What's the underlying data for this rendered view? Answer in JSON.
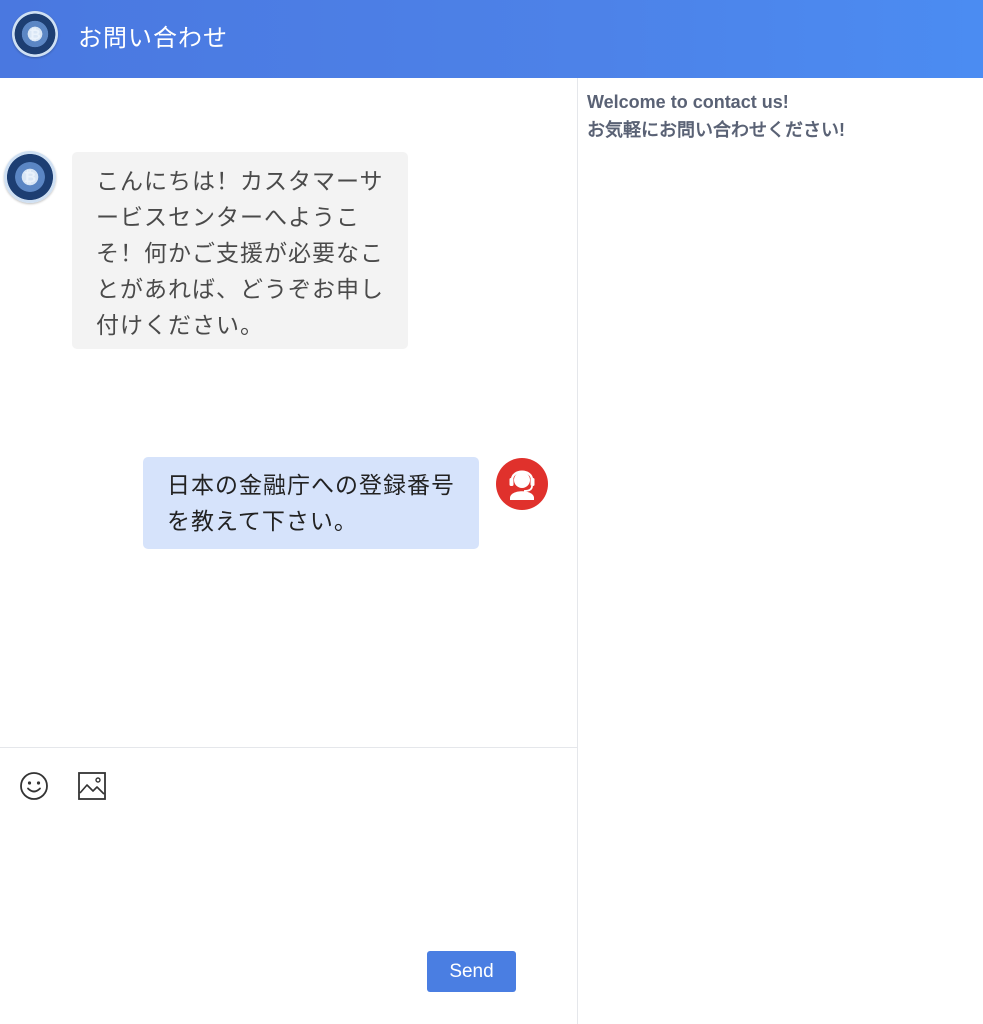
{
  "header": {
    "title": "お問い合わせ",
    "logo_icon": "bitcoin-logo-icon"
  },
  "messages": [
    {
      "sender": "agent",
      "avatar_icon": "bitcoin-logo-icon",
      "text": "こんにちは！カスタマーサービスセンターへようこそ！何かご支援が必要なことがあれば、どうぞお申し付けください。"
    },
    {
      "sender": "user",
      "avatar_icon": "headset-user-icon",
      "text": "日本の金融庁への登録番号を教えて下さい。"
    }
  ],
  "composer": {
    "tools": [
      {
        "name": "emoji",
        "icon": "smiley-icon"
      },
      {
        "name": "image",
        "icon": "image-icon"
      }
    ],
    "input_value": "",
    "send_label": "Send"
  },
  "sidebar": {
    "welcome_line1": "Welcome to contact us!",
    "welcome_line2": "お気軽にお問い合わせください!"
  },
  "colors": {
    "header_start": "#4a78e0",
    "header_end": "#4b8cf2",
    "bot_bubble": "#f3f3f3",
    "user_bubble": "#d6e3fb",
    "user_avatar": "#e0312c",
    "send_button": "#4a7ee2"
  }
}
